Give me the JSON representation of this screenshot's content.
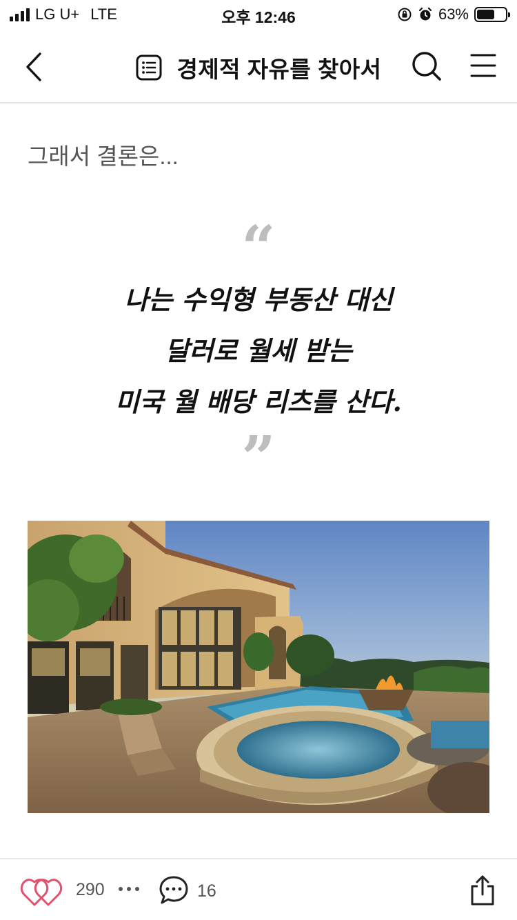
{
  "status_bar": {
    "carrier": "LG U+",
    "network": "LTE",
    "time": "오후 12:46",
    "battery_percent": "63%",
    "battery_level": 0.63
  },
  "nav": {
    "back_icon": "chevron-left-icon",
    "title_icon": "list-icon",
    "title": "경제적 자유를 찾아서",
    "search_icon": "search-icon",
    "menu_icon": "hamburger-menu-icon"
  },
  "article": {
    "intro": "그래서 결론은...",
    "quote_open": "“",
    "quote_lines": [
      "나는 수익형 부동산 대신",
      "달러로 월세 받는",
      "미국 월 배당 리츠를 산다."
    ],
    "quote_close": "”"
  },
  "bottom_bar": {
    "like_icon": "heart-icon",
    "like_count": "290",
    "more_icon": "more-dots-icon",
    "comment_icon": "comment-bubble-icon",
    "comment_count": "16",
    "share_icon": "share-icon"
  },
  "colors": {
    "like_accent": "#e2506e",
    "divider": "#e2e2e2",
    "quote_mark": "#bdbdbd"
  }
}
